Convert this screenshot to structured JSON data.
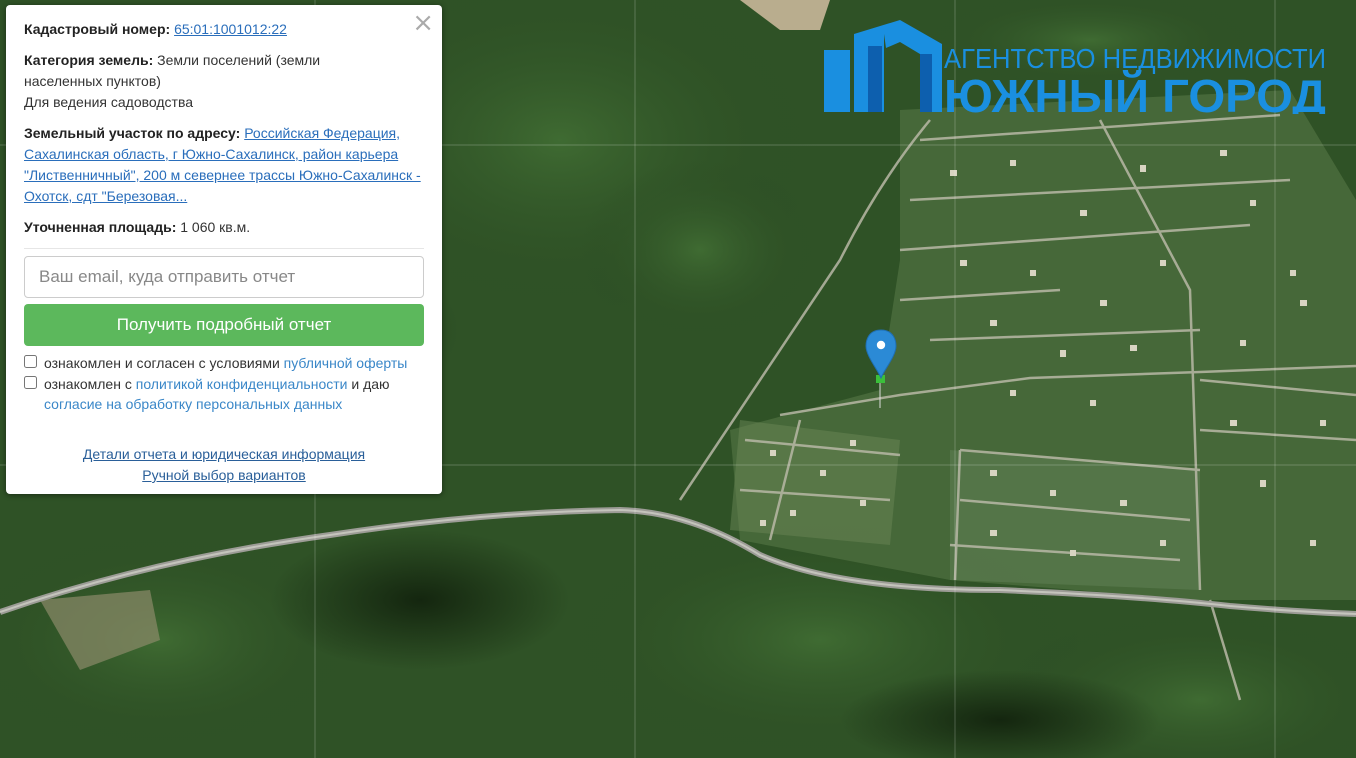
{
  "popup": {
    "close_icon": "×",
    "cadastral_label": "Кадастровый номер:",
    "cadastral_value": "65:01:1001012:22",
    "category_label": "Категория земель:",
    "category_value": "Земли поселений (земли населенных пунктов)",
    "category_use": "Для ведения садоводства",
    "address_label": "Земельный участок по адресу:",
    "address_value": "Российская Федерация, Сахалинская область, г Южно-Сахалинск, район карьера \"Лиственничный\", 200 м севернее трассы Южно-Сахалинск - Охотск, сдт \"Березовая...",
    "area_label": "Уточненная площадь:",
    "area_value": "1 060 кв.м.",
    "email_placeholder": "Ваш email, куда отправить отчет",
    "submit_label": "Получить подробный отчет",
    "agree1_text": "ознакомлен и согласен с условиями",
    "agree1_link": "публичной оферты",
    "agree2_text_a": "ознакомлен с",
    "agree2_link_a": "политикой конфиденциальности",
    "agree2_text_b": "и даю",
    "agree2_link_b": "согласие на обработку персональных данных",
    "details_link": "Детали отчета и юридическая информация",
    "manual_link": "Ручной выбор вариантов"
  },
  "logo": {
    "line1": "АГЕНТСТВО НЕДВИЖИМОСТИ",
    "line2": "ЮЖНЫЙ ГОРОД",
    "color": "#1a8fe0",
    "color_dark": "#0d5fae"
  },
  "map": {
    "marker_color": "#2b8ad6",
    "parcel_color": "#3bbf3b"
  }
}
